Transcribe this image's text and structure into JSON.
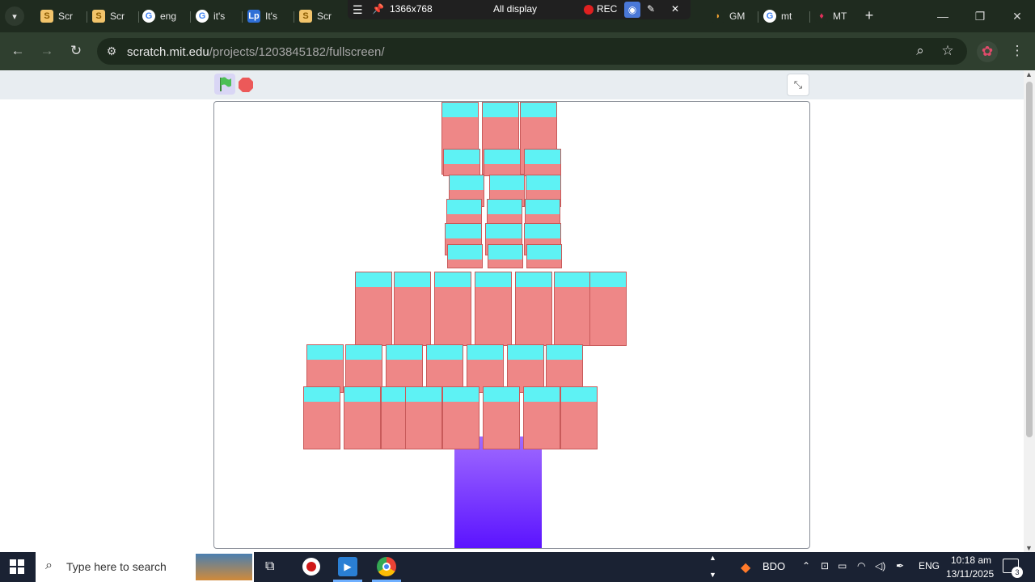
{
  "tabs": [
    {
      "label": "Scr",
      "icon": "scratch-icon"
    },
    {
      "label": "Scr",
      "icon": "scratch-icon"
    },
    {
      "label": "eng",
      "icon": "google-icon"
    },
    {
      "label": "it's",
      "icon": "google-icon"
    },
    {
      "label": "It's",
      "icon": "lp-icon"
    },
    {
      "label": "Scr",
      "icon": "scratch-icon"
    },
    {
      "label": "GM",
      "icon": "gm-icon"
    },
    {
      "label": "mt",
      "icon": "google-icon"
    },
    {
      "label": "MT",
      "icon": "mt-icon"
    }
  ],
  "recorder": {
    "resolution": "1366x768",
    "display": "All display",
    "rec_label": "REC"
  },
  "address_bar": {
    "url_host": "scratch.mit.edu",
    "url_path": "/projects/1203845182/fullscreen/"
  },
  "taskbar": {
    "search_placeholder": "Type here to search",
    "weather_label": "BDO",
    "language": "ENG",
    "time": "10:18 am",
    "date": "13/11/2025",
    "notification_count": "3"
  },
  "colors": {
    "browser_frame": "#1f2b1f",
    "stage_border": "#8a8f98",
    "sprite_body": "#ee8787",
    "sprite_head": "#5ef2f4",
    "trunk_top": "#a06bff",
    "trunk_bottom": "#5a12ff",
    "green_flag": "#4cbf56",
    "stop_sign": "#ec5959"
  }
}
